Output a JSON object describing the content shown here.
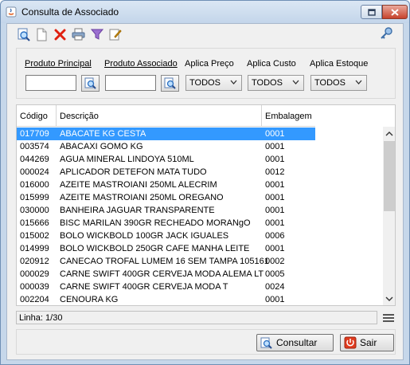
{
  "window": {
    "title": "Consulta de Associado"
  },
  "filters": {
    "produto_principal_label": "Produto Principal",
    "produto_associado_label": "Produto Associado",
    "aplica_preco_label": "Aplica Preço",
    "aplica_custo_label": "Aplica Custo",
    "aplica_estoque_label": "Aplica Estoque",
    "produto_principal_value": "",
    "produto_associado_value": "",
    "aplica_preco_value": "TODOS",
    "aplica_custo_value": "TODOS",
    "aplica_estoque_value": "TODOS"
  },
  "grid": {
    "columns": [
      "Código",
      "Descrição",
      "Embalagem"
    ],
    "rows": [
      {
        "codigo": "017709",
        "descricao": "ABACATE KG CESTA",
        "embalagem": "0001"
      },
      {
        "codigo": "003574",
        "descricao": "ABACAXI GOMO KG",
        "embalagem": "0001"
      },
      {
        "codigo": "044269",
        "descricao": "AGUA MINERAL LINDOYA 510ML",
        "embalagem": "0001"
      },
      {
        "codigo": "000024",
        "descricao": "APLICADOR DETEFON MATA TUDO",
        "embalagem": "0012"
      },
      {
        "codigo": "016000",
        "descricao": "AZEITE MASTROIANI 250ML ALECRIM",
        "embalagem": "0001"
      },
      {
        "codigo": "015999",
        "descricao": "AZEITE MASTROIANI 250ML OREGANO",
        "embalagem": "0001"
      },
      {
        "codigo": "030000",
        "descricao": "BANHEIRA JAGUAR TRANSPARENTE",
        "embalagem": "0001"
      },
      {
        "codigo": "015666",
        "descricao": "BISC MARILAN 390GR RECHEADO MORANgO",
        "embalagem": "0001"
      },
      {
        "codigo": "015002",
        "descricao": "BOLO WICKBOLD 100GR JACK IGUALES",
        "embalagem": "0006"
      },
      {
        "codigo": "014999",
        "descricao": "BOLO WICKBOLD 250GR CAFE MANHA LEITE",
        "embalagem": "0001"
      },
      {
        "codigo": "020912",
        "descricao": "CANECAO TROFAL LUMEM 16 SEM TAMPA 105161",
        "embalagem": "0002"
      },
      {
        "codigo": "000029",
        "descricao": "CARNE SWIFT 400GR CERVEJA MODA ALEMA LT",
        "embalagem": "0005"
      },
      {
        "codigo": "000039",
        "descricao": "CARNE SWIFT 400GR CERVEJA MODA T",
        "embalagem": "0024"
      },
      {
        "codigo": "002204",
        "descricao": "CENOURA KG",
        "embalagem": "0001"
      }
    ]
  },
  "status": {
    "text": "Linha: 1/30"
  },
  "buttons": {
    "consultar": "Consultar",
    "sair": "Sair"
  },
  "colors": {
    "selection": "#3399ff",
    "client_bg": "#f0f0f0",
    "frame": "#c6d7ea"
  }
}
